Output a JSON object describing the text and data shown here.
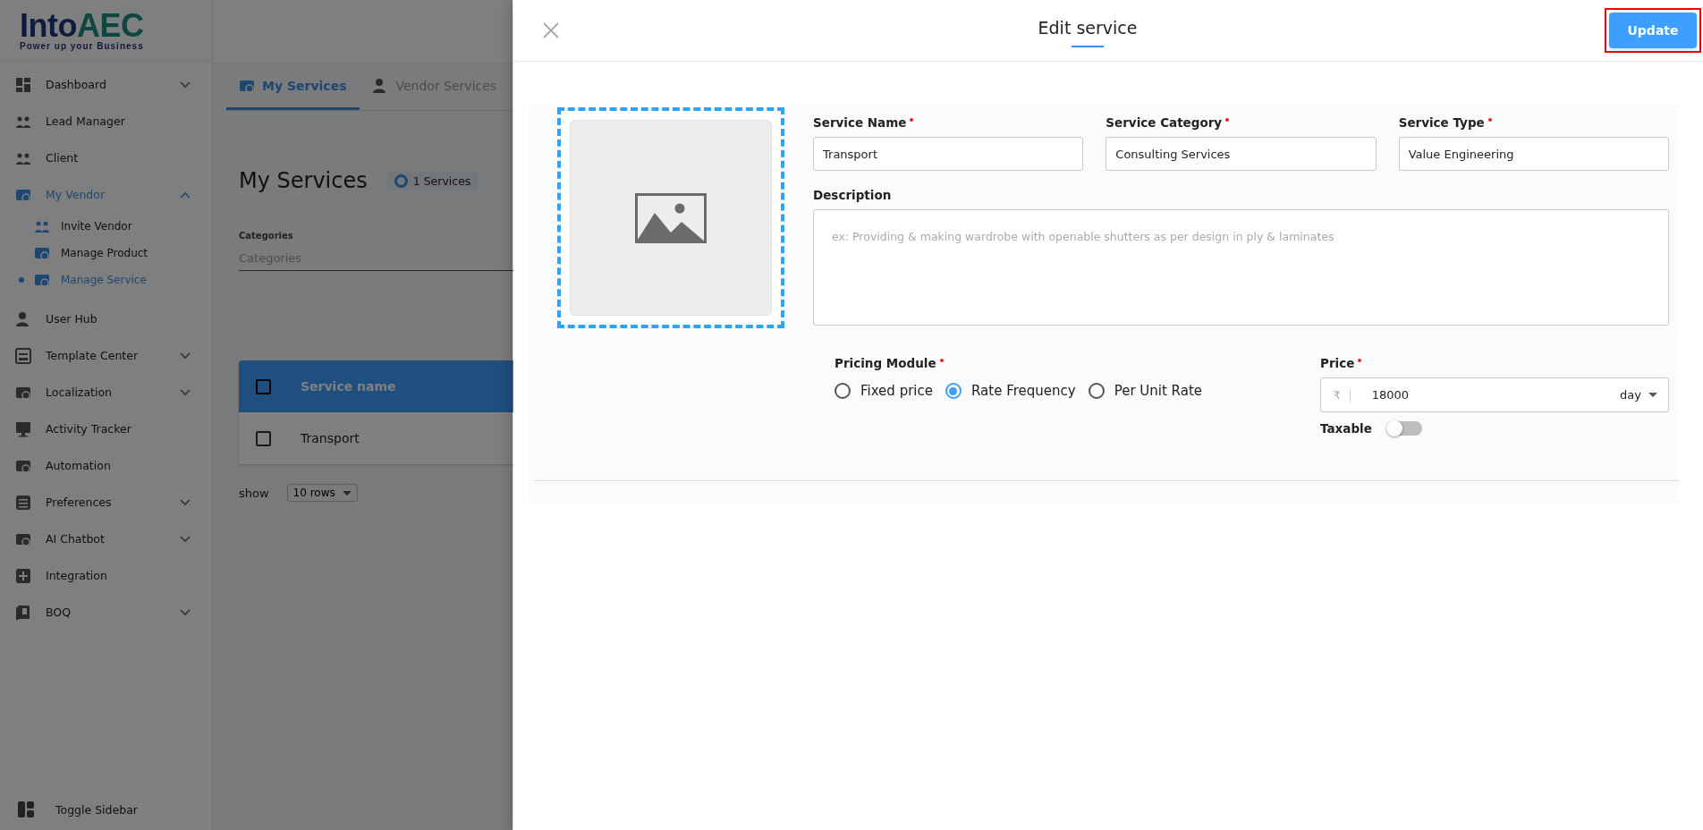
{
  "logo": {
    "primary": "Into",
    "accent": "AEC",
    "tagline": "Power up your Business"
  },
  "sidebar": {
    "items": [
      {
        "label": "Dashboard",
        "kind": "group",
        "expanded": false,
        "selected": false
      },
      {
        "label": "Lead Manager",
        "kind": "link",
        "selected": false
      },
      {
        "label": "Client",
        "kind": "link",
        "selected": false
      },
      {
        "label": "My Vendor",
        "kind": "group",
        "expanded": true,
        "selected": false,
        "children": [
          {
            "label": "Invite Vendor",
            "selected": false
          },
          {
            "label": "Manage Product",
            "selected": false
          },
          {
            "label": "Manage Service",
            "selected": true
          }
        ]
      },
      {
        "label": "User Hub",
        "kind": "link",
        "selected": false
      },
      {
        "label": "Template Center",
        "kind": "group",
        "expanded": false,
        "selected": false
      },
      {
        "label": "Localization",
        "kind": "group",
        "expanded": false,
        "selected": false
      },
      {
        "label": "Activity Tracker",
        "kind": "link",
        "selected": false
      },
      {
        "label": "Automation",
        "kind": "link",
        "selected": false
      },
      {
        "label": "Preferences",
        "kind": "group",
        "expanded": false,
        "selected": false
      },
      {
        "label": "AI Chatbot",
        "kind": "group",
        "expanded": false,
        "selected": false
      },
      {
        "label": "Integration",
        "kind": "link",
        "selected": false
      },
      {
        "label": "BOQ",
        "kind": "group",
        "expanded": false,
        "selected": false
      }
    ],
    "toggle": "Toggle Sidebar"
  },
  "page": {
    "tabs": [
      {
        "label": "My Services",
        "selected": true
      },
      {
        "label": "Vendor Services",
        "selected": false
      }
    ],
    "heading": "My Services",
    "count_badge": "1 Services",
    "filter": {
      "label": "Categories",
      "placeholder": "Categories"
    },
    "table": {
      "header_checked": false,
      "columns": [
        "Service name"
      ],
      "rows": [
        {
          "name": "Transport",
          "checked": false
        }
      ]
    },
    "pagination": {
      "label": "show",
      "rows": "10 rows"
    }
  },
  "drawer": {
    "title": "Edit service",
    "update": "Update",
    "update_highlighted": true,
    "fields": [
      {
        "label": "Service Name",
        "required": true,
        "value": "Transport"
      },
      {
        "label": "Service Category",
        "required": true,
        "value": "Consulting Services"
      },
      {
        "label": "Service Type",
        "required": true,
        "value": "Value Engineering"
      }
    ],
    "description": {
      "label": "Description",
      "required": false,
      "placeholder": "ex: Providing & making wardrobe with openable shutters as per design in ply & laminates"
    },
    "pricing": {
      "label": "Pricing Module",
      "required": true,
      "options": [
        {
          "label": "Fixed price",
          "selected": false
        },
        {
          "label": "Rate Frequency",
          "selected": true
        },
        {
          "label": "Per Unit Rate",
          "selected": false
        }
      ]
    },
    "price": {
      "label": "Price",
      "required": true,
      "currency": "₹",
      "value": "18000",
      "unit": "day"
    },
    "taxable": {
      "label": "Taxable",
      "on": false
    }
  }
}
